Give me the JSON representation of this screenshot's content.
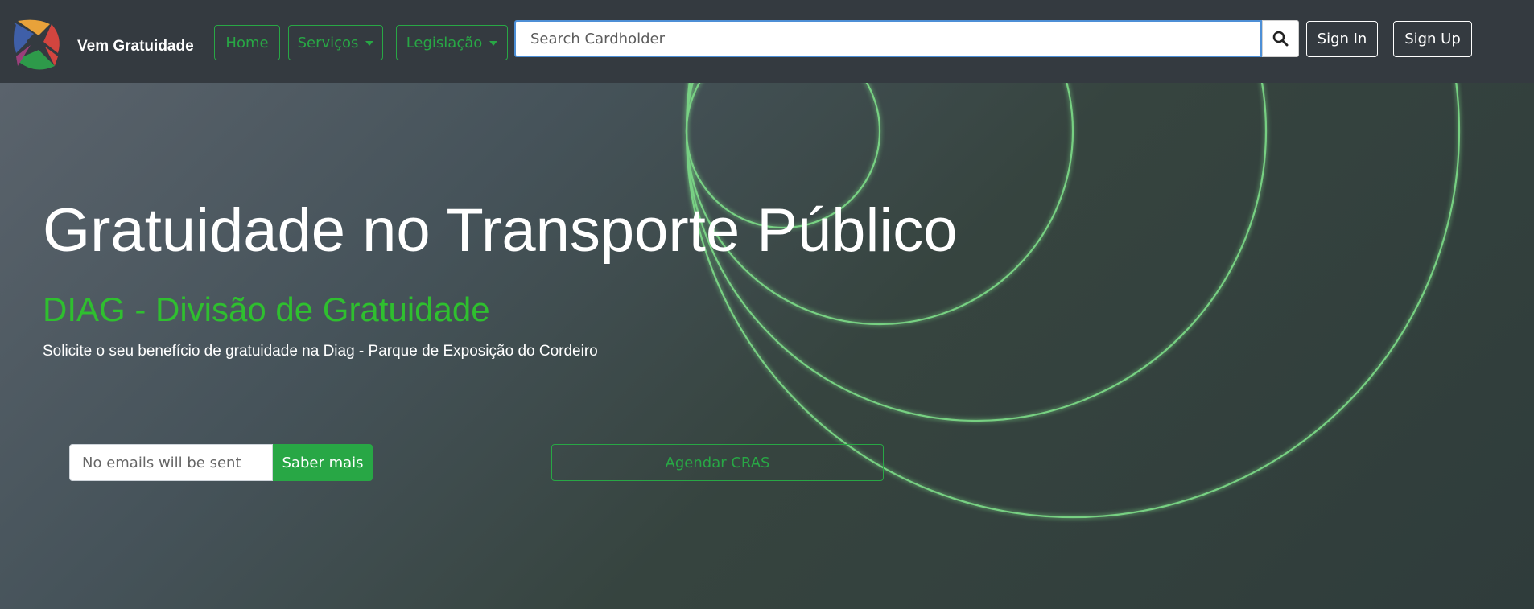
{
  "navbar": {
    "brand": "Vem Gratuidade",
    "home_label": "Home",
    "servicos_label": "Serviços",
    "legislacao_label": "Legislação",
    "search": {
      "placeholder": "Search Cardholder"
    },
    "sign_in_label": "Sign In",
    "sign_up_label": "Sign Up"
  },
  "hero": {
    "title": "Gratuidade no Transporte Público",
    "subtitle": "DIAG - Divisão de Gratuidade",
    "description": "Solicite o seu benefício de gratuidade na Diag - Parque de Exposição do Cordeiro",
    "email": {
      "placeholder": "No emails will be sent"
    },
    "saber_mais_label": "Saber mais",
    "agendar_label": "Agendar CRAS"
  },
  "colors": {
    "navbar_bg": "#343a40",
    "accent_green": "#28a745",
    "subtitle_green": "#2fbf2f",
    "ring_green": "#7fe08a"
  },
  "icons": {
    "logo": "vem-gratuidade-x-logo",
    "search": "search-icon",
    "dropdown": "caret-down-icon"
  }
}
